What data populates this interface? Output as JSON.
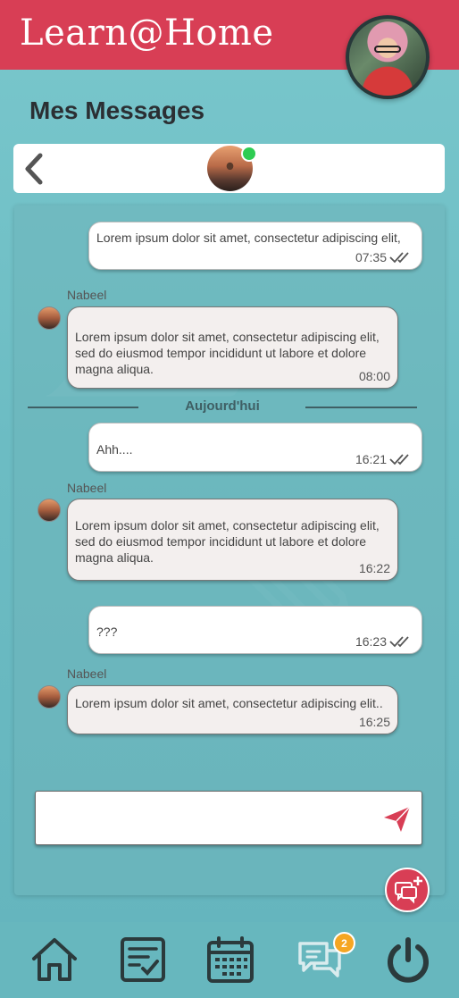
{
  "app": {
    "title": "Learn@Home"
  },
  "page": {
    "title": "Mes Messages"
  },
  "contact": {
    "online": true,
    "status_color": "#2ecc52"
  },
  "messages": [
    {
      "direction": "out",
      "text": "Lorem ipsum dolor sit amet, consectetur adipiscing elit,",
      "time": "07:35",
      "read": true
    },
    {
      "direction": "in",
      "sender": "Nabeel",
      "text": "Lorem ipsum dolor sit amet, consectetur adipiscing elit, sed do eiusmod tempor incididunt ut labore et dolore magna aliqua.",
      "time": "08:00"
    },
    {
      "direction": "out",
      "text": "Ahh....",
      "time": "16:21",
      "read": true
    },
    {
      "direction": "in",
      "sender": "Nabeel",
      "text": "Lorem ipsum dolor sit amet, consectetur adipiscing elit, sed do eiusmod tempor incididunt ut labore et dolore magna aliqua.",
      "time": "16:22"
    },
    {
      "direction": "out",
      "text": "???",
      "time": "16:23",
      "read": true
    },
    {
      "direction": "in",
      "sender": "Nabeel",
      "text": "Lorem ipsum dolor sit amet, consectetur adipiscing elit..",
      "time": "16:25"
    }
  ],
  "divider": {
    "label": "Aujourd'hui"
  },
  "composer": {
    "value": "",
    "placeholder": ""
  },
  "nav": {
    "items": [
      {
        "icon": "home-icon"
      },
      {
        "icon": "tasks-icon"
      },
      {
        "icon": "calendar-icon"
      },
      {
        "icon": "messages-icon",
        "badge": "2"
      },
      {
        "icon": "power-icon"
      }
    ]
  },
  "colors": {
    "accent": "#d83e55",
    "background": "#6cbcc3",
    "badge": "#f5a623",
    "nav_icon": "#2b3a3c"
  }
}
